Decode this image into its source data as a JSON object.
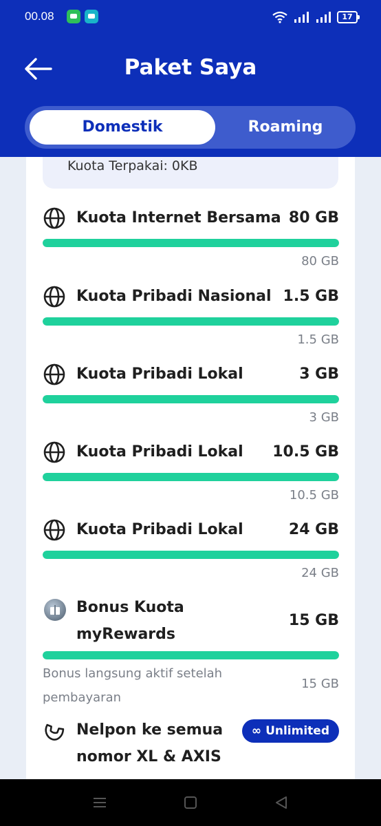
{
  "status_bar": {
    "time": "00.08",
    "battery": "17"
  },
  "header": {
    "title": "Paket Saya"
  },
  "tabs": [
    {
      "label": "Domestik"
    },
    {
      "label": "Roaming"
    }
  ],
  "summary": {
    "text": "Kuota Terpakai: 0KB"
  },
  "items": [
    {
      "icon": "globe-icon",
      "name": "Kuota Internet Bersama",
      "amount": "80 GB",
      "remaining": "80 GB",
      "fill_percent": 100
    },
    {
      "icon": "globe-icon",
      "name": "Kuota Pribadi Nasional",
      "amount": "1.5 GB",
      "remaining": "1.5 GB",
      "fill_percent": 100
    },
    {
      "icon": "globe-icon",
      "name": "Kuota Pribadi Lokal",
      "amount": "3 GB",
      "remaining": "3 GB",
      "fill_percent": 100
    },
    {
      "icon": "globe-icon",
      "name": "Kuota Pribadi Lokal",
      "amount": "10.5 GB",
      "remaining": "10.5 GB",
      "fill_percent": 100
    },
    {
      "icon": "globe-icon",
      "name": "Kuota Pribadi Lokal",
      "amount": "24 GB",
      "remaining": "24 GB",
      "fill_percent": 100
    }
  ],
  "bonus": {
    "icon": "gift-icon",
    "name_line1": "Bonus Kuota",
    "name_line2": "myRewards",
    "amount": "15 GB",
    "note": "Bonus langsung aktif setelah pembayaran",
    "remaining": "15 GB",
    "fill_percent": 100
  },
  "call": {
    "icon": "phone-icon",
    "name_line1": "Nelpon ke semua",
    "name_line2": "nomor XL & AXIS",
    "badge_icon": "infinity-icon",
    "badge": "Unlimited"
  },
  "colors": {
    "brand_blue": "#0d2fb9",
    "progress_green": "#1fd19c"
  }
}
